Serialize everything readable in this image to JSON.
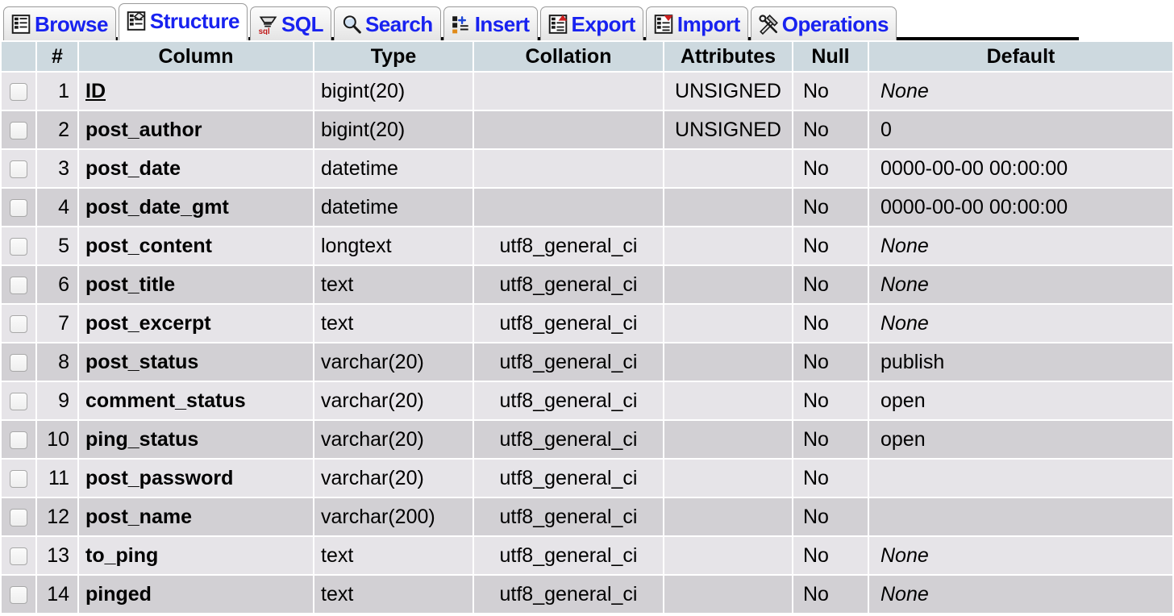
{
  "nav": {
    "tabs": [
      {
        "label": "Browse",
        "icon": "browse-table-icon",
        "active": false
      },
      {
        "label": "Structure",
        "icon": "structure-icon",
        "active": true
      },
      {
        "label": "SQL",
        "icon": "sql-icon",
        "active": false
      },
      {
        "label": "Search",
        "icon": "magnifier-icon",
        "active": false
      },
      {
        "label": "Insert",
        "icon": "insert-row-icon",
        "active": false
      },
      {
        "label": "Export",
        "icon": "export-icon",
        "active": false
      },
      {
        "label": "Import",
        "icon": "import-icon",
        "active": false
      },
      {
        "label": "Operations",
        "icon": "hammer-wrench-icon",
        "active": false
      }
    ],
    "link_color": "#1822f0",
    "rule_color": "#000000"
  },
  "table": {
    "headers": {
      "check": "",
      "num": "#",
      "column": "Column",
      "type": "Type",
      "collation": "Collation",
      "attributes": "Attributes",
      "null": "Null",
      "default": "Default"
    },
    "header_bg": "#cdd9df",
    "row_bg_odd": "#e6e4e8",
    "row_bg_even": "#d2d0d4",
    "rows": [
      {
        "num": "1",
        "column": "ID",
        "primary_key": true,
        "type": "bigint(20)",
        "collation": "",
        "attributes": "UNSIGNED",
        "null": "No",
        "default": "None",
        "default_italic": true
      },
      {
        "num": "2",
        "column": "post_author",
        "primary_key": false,
        "type": "bigint(20)",
        "collation": "",
        "attributes": "UNSIGNED",
        "null": "No",
        "default": "0",
        "default_italic": false
      },
      {
        "num": "3",
        "column": "post_date",
        "primary_key": false,
        "type": "datetime",
        "collation": "",
        "attributes": "",
        "null": "No",
        "default": "0000-00-00 00:00:00",
        "default_italic": false
      },
      {
        "num": "4",
        "column": "post_date_gmt",
        "primary_key": false,
        "type": "datetime",
        "collation": "",
        "attributes": "",
        "null": "No",
        "default": "0000-00-00 00:00:00",
        "default_italic": false
      },
      {
        "num": "5",
        "column": "post_content",
        "primary_key": false,
        "type": "longtext",
        "collation": "utf8_general_ci",
        "attributes": "",
        "null": "No",
        "default": "None",
        "default_italic": true
      },
      {
        "num": "6",
        "column": "post_title",
        "primary_key": false,
        "type": "text",
        "collation": "utf8_general_ci",
        "attributes": "",
        "null": "No",
        "default": "None",
        "default_italic": true
      },
      {
        "num": "7",
        "column": "post_excerpt",
        "primary_key": false,
        "type": "text",
        "collation": "utf8_general_ci",
        "attributes": "",
        "null": "No",
        "default": "None",
        "default_italic": true
      },
      {
        "num": "8",
        "column": "post_status",
        "primary_key": false,
        "type": "varchar(20)",
        "collation": "utf8_general_ci",
        "attributes": "",
        "null": "No",
        "default": "publish",
        "default_italic": false
      },
      {
        "num": "9",
        "column": "comment_status",
        "primary_key": false,
        "type": "varchar(20)",
        "collation": "utf8_general_ci",
        "attributes": "",
        "null": "No",
        "default": "open",
        "default_italic": false
      },
      {
        "num": "10",
        "column": "ping_status",
        "primary_key": false,
        "type": "varchar(20)",
        "collation": "utf8_general_ci",
        "attributes": "",
        "null": "No",
        "default": "open",
        "default_italic": false
      },
      {
        "num": "11",
        "column": "post_password",
        "primary_key": false,
        "type": "varchar(20)",
        "collation": "utf8_general_ci",
        "attributes": "",
        "null": "No",
        "default": "",
        "default_italic": false
      },
      {
        "num": "12",
        "column": "post_name",
        "primary_key": false,
        "type": "varchar(200)",
        "collation": "utf8_general_ci",
        "attributes": "",
        "null": "No",
        "default": "",
        "default_italic": false
      },
      {
        "num": "13",
        "column": "to_ping",
        "primary_key": false,
        "type": "text",
        "collation": "utf8_general_ci",
        "attributes": "",
        "null": "No",
        "default": "None",
        "default_italic": true
      },
      {
        "num": "14",
        "column": "pinged",
        "primary_key": false,
        "type": "text",
        "collation": "utf8_general_ci",
        "attributes": "",
        "null": "No",
        "default": "None",
        "default_italic": true
      }
    ]
  }
}
